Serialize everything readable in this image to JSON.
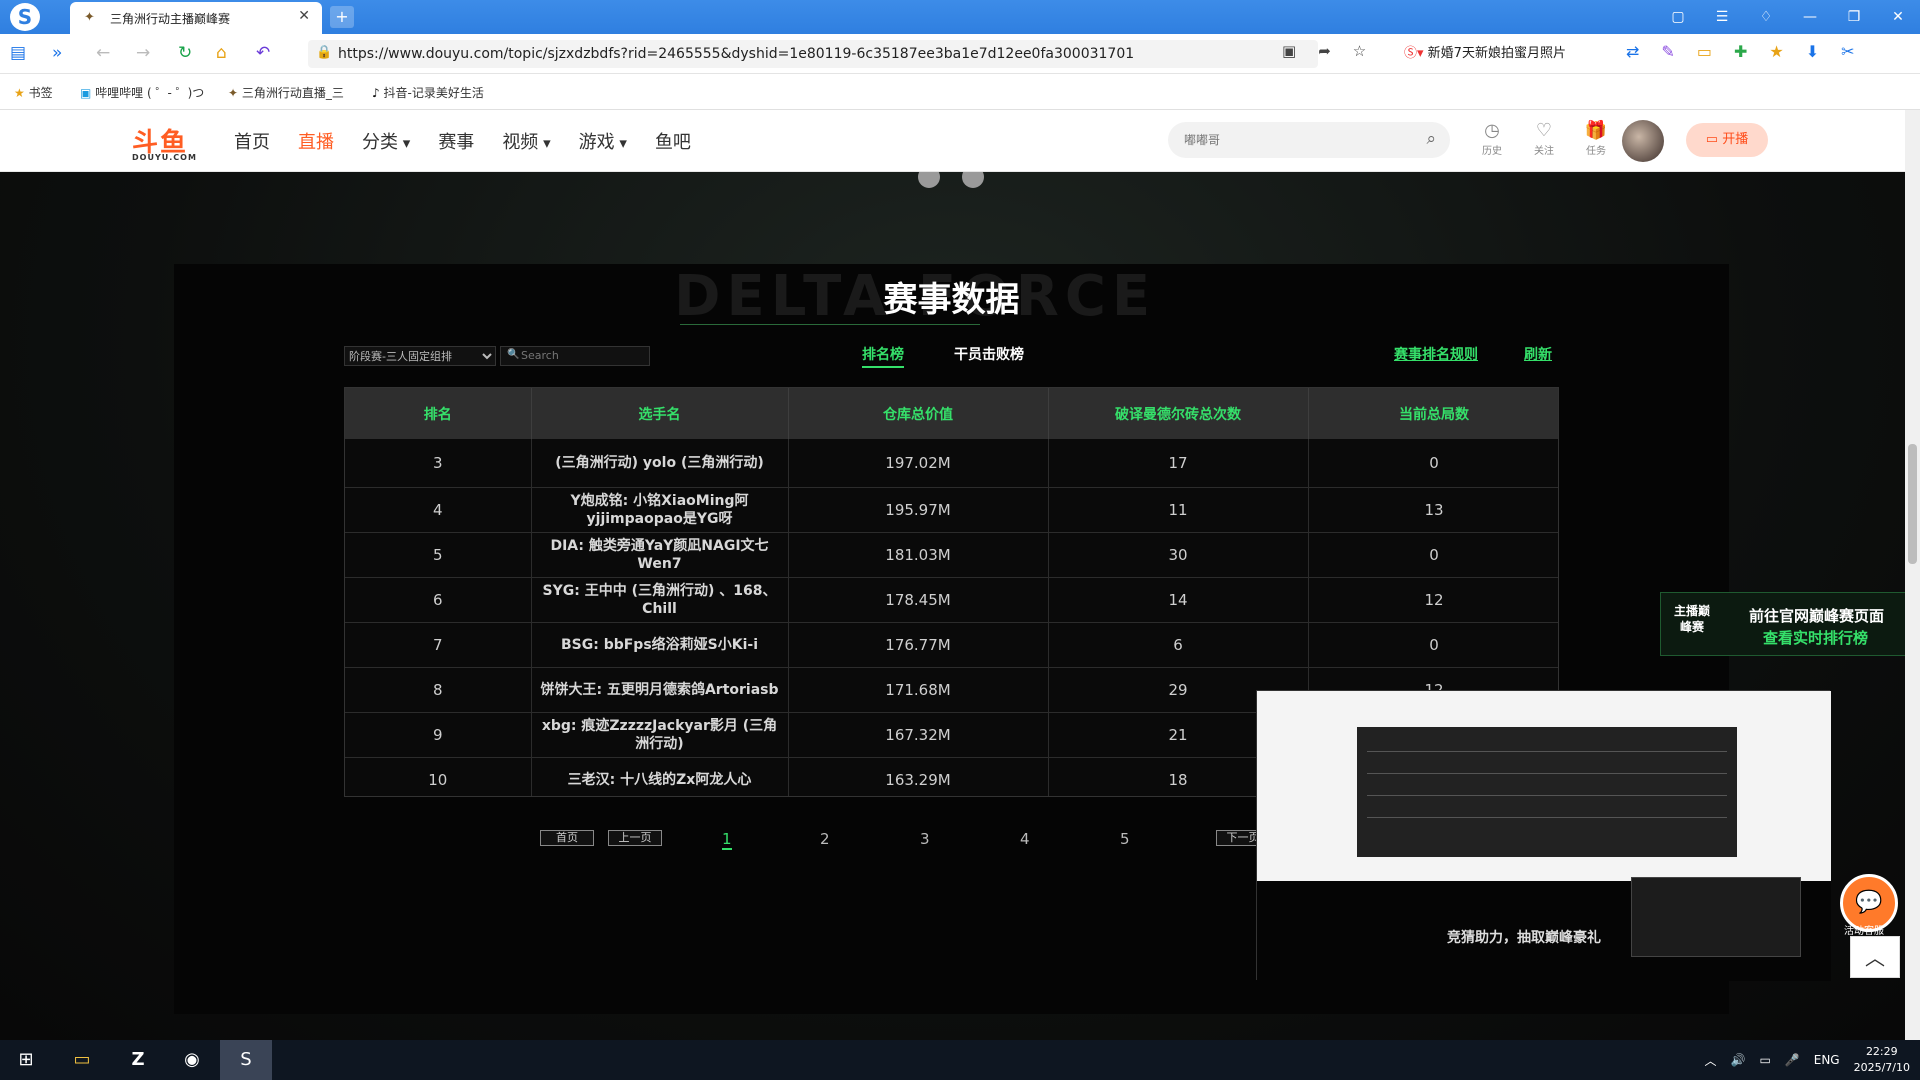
{
  "browser": {
    "tab_title": "三角洲行动主播巅峰赛",
    "url": "https://www.douyu.com/topic/sjzxdzbdfs?rid=2465555&dyshid=1e80119-6c35187ee3ba1e7d12ee0fa300031701",
    "news_text": "新婚7天新娘拍蜜月照片",
    "bookmarks": [
      "书签",
      "哔哩哔哩 ( ゜- ゜)つ",
      "三角洲行动直播_三",
      "抖音-记录美好生活"
    ]
  },
  "site": {
    "logo": "斗鱼",
    "logo_sub": "DOUYU.COM",
    "nav": [
      "首页",
      "直播",
      "分类",
      "赛事",
      "视频",
      "游戏",
      "鱼吧"
    ],
    "search_placeholder": "嘟嘟哥",
    "header_icons": [
      {
        "icon": "history-icon",
        "label": "历史"
      },
      {
        "icon": "follow-icon",
        "label": "关注"
      },
      {
        "icon": "task-icon",
        "label": "任务"
      }
    ],
    "live_button": "开播"
  },
  "event": {
    "bg_word": "DELTA FORCE",
    "title": "赛事数据",
    "filter_selected": "阶段赛-三人固定组排",
    "search_placeholder": "Search",
    "tab_rank": "排名榜",
    "tab_kill": "干员击败榜",
    "rules_link": "赛事排名规则",
    "refresh_link": "刷新",
    "columns": [
      "排名",
      "选手名",
      "仓库总价值",
      "破译曼德尔砖总次数",
      "当前总局数"
    ],
    "rows": [
      {
        "rank": "3",
        "player": "(三角洲行动) yolo (三角洲行动)",
        "value": "197.02M",
        "bricks": "17",
        "games": "0"
      },
      {
        "rank": "4",
        "player": "Y炮成铭: 小铭XiaoMing阿yjjimpaopao是YG呀",
        "value": "195.97M",
        "bricks": "11",
        "games": "13"
      },
      {
        "rank": "5",
        "player": "DIA: 触类旁通YaY颜凪NAGI文七Wen7",
        "value": "181.03M",
        "bricks": "30",
        "games": "0"
      },
      {
        "rank": "6",
        "player": "SYG: 王中中 (三角洲行动) 、168、Chill",
        "value": "178.45M",
        "bricks": "14",
        "games": "12"
      },
      {
        "rank": "7",
        "player": "BSG: bbFps络浴莉娅S小Ki-i",
        "value": "176.77M",
        "bricks": "6",
        "games": "0"
      },
      {
        "rank": "8",
        "player": "饼饼大王: 五更明月德索鸽Artoriasb",
        "value": "171.68M",
        "bricks": "29",
        "games": "12"
      },
      {
        "rank": "9",
        "player": "xbg: 痕迹ZzzzzJackyar影月 (三角洲行动)",
        "value": "167.32M",
        "bricks": "21",
        "games": ""
      },
      {
        "rank": "10",
        "player": "三老汉: 十八线的Zx阿龙人心",
        "value": "163.29M",
        "bricks": "18",
        "games": ""
      }
    ],
    "pager": {
      "first": "首页",
      "prev": "上一页",
      "pages": [
        "1",
        "2",
        "3",
        "4",
        "5"
      ],
      "current": "1",
      "next": "下一页"
    }
  },
  "promo": {
    "badge": "主播巅峰赛",
    "line1": "前往官网巅峰赛页面",
    "line2": "查看实时排行榜"
  },
  "mini_player": {
    "caption": "竞猜助力，抽取巅峰豪礼"
  },
  "support": {
    "label": "活动客服"
  },
  "taskbar": {
    "lang": "ENG",
    "time": "22:29",
    "date": "2025/7/10"
  },
  "colors": {
    "accent_green": "#35e06a",
    "brand_orange": "#ff5d23"
  }
}
